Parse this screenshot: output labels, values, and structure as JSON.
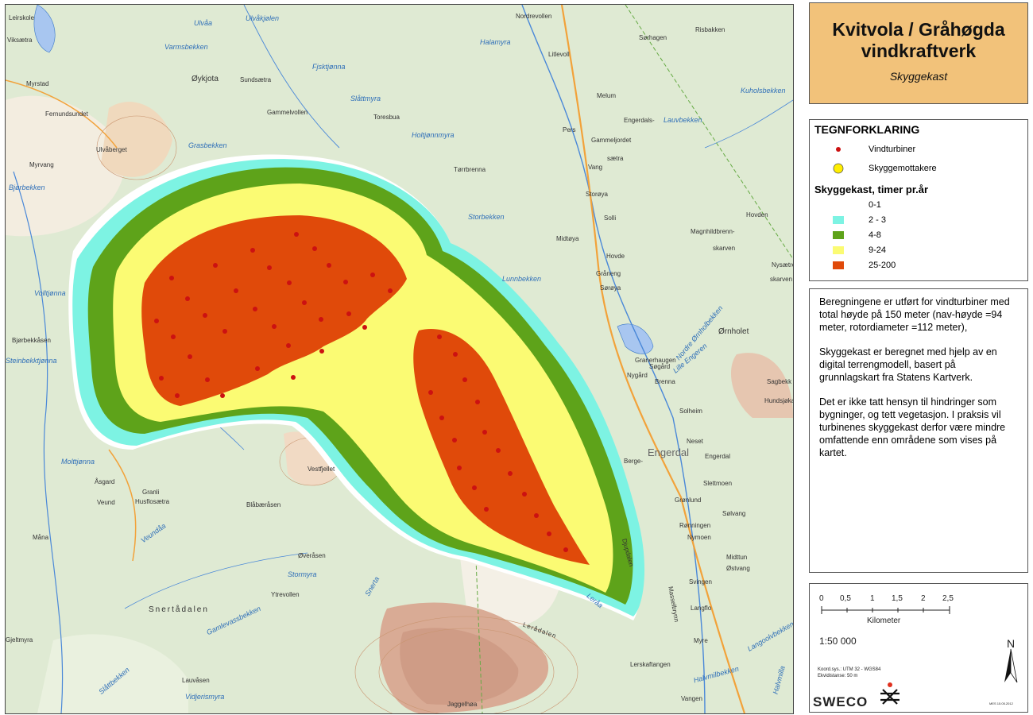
{
  "title": {
    "main": "Kvitvola / Gråhøgda vindkraftverk",
    "subtitle": "Skyggekast"
  },
  "legend": {
    "heading": "TEGNFORKLARING",
    "symbols": [
      {
        "label": "Vindturbiner",
        "color": "#cc1111"
      },
      {
        "label": "Skyggemottakere",
        "color": "#ffee00"
      }
    ],
    "classes_heading": "Skyggekast, timer pr.år",
    "classes": [
      {
        "label": "0-1",
        "color": "#ffffff"
      },
      {
        "label": "2 - 3",
        "color": "#7df3e3"
      },
      {
        "label": "4-8",
        "color": "#5ea31a"
      },
      {
        "label": "9-24",
        "color": "#fbfb73"
      },
      {
        "label": "25-200",
        "color": "#e04a0a"
      }
    ]
  },
  "notes": [
    "Beregningene er utført for vindturbiner med total høyde på 150 meter (nav-høyde =94 meter, rotordiameter =112 meter),",
    "Skyggekast er beregnet med hjelp av en digital terrengmodell, basert på grunnlagskart fra Statens Kartverk.",
    "Det er ikke tatt hensyn til hindringer som bygninger, og tett vegetasjon. I praksis vil turbinenes skyggekast derfor være mindre omfattende enn områdene som vises på kartet."
  ],
  "scalebar": {
    "ticks": [
      "0",
      "0,5",
      "1",
      "1,5",
      "2",
      "2,5"
    ],
    "unit": "Kilometer",
    "ratio": "1:50 000",
    "coord_sys": "Koord.sys.: UTM 32 - WGS84",
    "equidistance": "Ekvidistanse: 50 m",
    "north": "N",
    "logo": "SWECO",
    "stamp": "MES 15.05.2012"
  },
  "map_labels": [
    {
      "text": "Leirskole",
      "kind": "place"
    },
    {
      "text": "Viksætra",
      "kind": "place"
    },
    {
      "text": "Ulvåa",
      "kind": "water"
    },
    {
      "text": "Ulvåkjølen",
      "kind": "water"
    },
    {
      "text": "Varmsbekken",
      "kind": "water"
    },
    {
      "text": "Nordrevollen",
      "kind": "place"
    },
    {
      "text": "Halamyra",
      "kind": "water"
    },
    {
      "text": "Litlevoll",
      "kind": "place"
    },
    {
      "text": "Risbakken",
      "kind": "place"
    },
    {
      "text": "Sørhagen",
      "kind": "place"
    },
    {
      "text": "Myrstad",
      "kind": "place"
    },
    {
      "text": "Fjsktjønna",
      "kind": "water"
    },
    {
      "text": "Øykjota",
      "kind": "big"
    },
    {
      "text": "Sundsætra",
      "kind": "place"
    },
    {
      "text": "Slåttmyra",
      "kind": "water"
    },
    {
      "text": "Melum",
      "kind": "place"
    },
    {
      "text": "Kuholsbekken",
      "kind": "water"
    },
    {
      "text": "Fernundsundet",
      "kind": "place"
    },
    {
      "text": "Gammelvollen",
      "kind": "place"
    },
    {
      "text": "Toresbua",
      "kind": "place"
    },
    {
      "text": "Engerdals-",
      "kind": "place"
    },
    {
      "text": "Lauvbekken",
      "kind": "water"
    },
    {
      "text": "Ulvåberget",
      "kind": "place"
    },
    {
      "text": "Grasbekken",
      "kind": "water"
    },
    {
      "text": "Holtjønnmyra",
      "kind": "water"
    },
    {
      "text": "Pers",
      "kind": "place"
    },
    {
      "text": "Gammeljordet",
      "kind": "place"
    },
    {
      "text": "Myrvang",
      "kind": "place"
    },
    {
      "text": "Bjørbekken",
      "kind": "water"
    },
    {
      "text": "Tørrbrenna",
      "kind": "place"
    },
    {
      "text": "sætra",
      "kind": "place"
    },
    {
      "text": "Vang",
      "kind": "place"
    },
    {
      "text": "Storøya",
      "kind": "place"
    },
    {
      "text": "Storbekken",
      "kind": "water"
    },
    {
      "text": "Solli",
      "kind": "place"
    },
    {
      "text": "Hovden",
      "kind": "place"
    },
    {
      "text": "Magnhildbrenn-",
      "kind": "place"
    },
    {
      "text": "skarven",
      "kind": "place"
    },
    {
      "text": "Midtøya",
      "kind": "place"
    },
    {
      "text": "Lunnbekken",
      "kind": "water"
    },
    {
      "text": "Hovde",
      "kind": "place"
    },
    {
      "text": "Nysætre",
      "kind": "place"
    },
    {
      "text": "skarven",
      "kind": "place"
    },
    {
      "text": "Volltjønna",
      "kind": "water"
    },
    {
      "text": "Gråneng",
      "kind": "place"
    },
    {
      "text": "Sørøya",
      "kind": "place"
    },
    {
      "text": "Nordre Ørnholbekken",
      "kind": "water"
    },
    {
      "text": "Ørnholet",
      "kind": "big"
    },
    {
      "text": "Bjørbekkåsen",
      "kind": "place"
    },
    {
      "text": "Steinbekktjønna",
      "kind": "water"
    },
    {
      "text": "Lille Engeren",
      "kind": "water"
    },
    {
      "text": "Granerhaugen",
      "kind": "place"
    },
    {
      "text": "Sagbekk",
      "kind": "place"
    },
    {
      "text": "Hundsjøkar",
      "kind": "place"
    },
    {
      "text": "Nygård",
      "kind": "place"
    },
    {
      "text": "Søgård",
      "kind": "place"
    },
    {
      "text": "Brenna",
      "kind": "place"
    },
    {
      "text": "Solheim",
      "kind": "place"
    },
    {
      "text": "Neset",
      "kind": "place"
    },
    {
      "text": "Engerdal",
      "kind": "big"
    },
    {
      "text": "Engerdal",
      "kind": "place"
    },
    {
      "text": "Molttjønna",
      "kind": "water"
    },
    {
      "text": "Vestfjellet",
      "kind": "place"
    },
    {
      "text": "Berge-",
      "kind": "place"
    },
    {
      "text": "Åsgard",
      "kind": "place"
    },
    {
      "text": "Granli",
      "kind": "place"
    },
    {
      "text": "Veund",
      "kind": "place"
    },
    {
      "text": "Husflosætra",
      "kind": "place"
    },
    {
      "text": "Slettmoen",
      "kind": "place"
    },
    {
      "text": "Grønlund",
      "kind": "place"
    },
    {
      "text": "Sølvang",
      "kind": "place"
    },
    {
      "text": "Veundåa",
      "kind": "water"
    },
    {
      "text": "Blåbæråsen",
      "kind": "place"
    },
    {
      "text": "Rønningen",
      "kind": "place"
    },
    {
      "text": "Nymoen",
      "kind": "place"
    },
    {
      "text": "Måna",
      "kind": "place"
    },
    {
      "text": "Djupdalen",
      "kind": "place"
    },
    {
      "text": "Øveråsen",
      "kind": "place"
    },
    {
      "text": "Midttun",
      "kind": "place"
    },
    {
      "text": "Østvang",
      "kind": "place"
    },
    {
      "text": "Stormyra",
      "kind": "water"
    },
    {
      "text": "Ytrevollen",
      "kind": "place"
    },
    {
      "text": "Snerta",
      "kind": "water"
    },
    {
      "text": "Svingen",
      "kind": "place"
    },
    {
      "text": "Snertådalen",
      "kind": "big"
    },
    {
      "text": "Gamlevassbekken",
      "kind": "water"
    },
    {
      "text": "Leråa",
      "kind": "water"
    },
    {
      "text": "Langflo",
      "kind": "place"
    },
    {
      "text": "Gjeltmyra",
      "kind": "place"
    },
    {
      "text": "Lerådalen",
      "kind": "place"
    },
    {
      "text": "Myre",
      "kind": "place"
    },
    {
      "text": "Masselbrynn",
      "kind": "place"
    },
    {
      "text": "Langoolvbekken",
      "kind": "water"
    },
    {
      "text": "Lerskaftangen",
      "kind": "place"
    },
    {
      "text": "Halvmilbekken",
      "kind": "water"
    },
    {
      "text": "Lauvåsen",
      "kind": "place"
    },
    {
      "text": "Vidjerismyra",
      "kind": "water"
    },
    {
      "text": "Slåttbekken",
      "kind": "water"
    },
    {
      "text": "Jaggelhøa",
      "kind": "place"
    },
    {
      "text": "Vangen",
      "kind": "place"
    },
    {
      "text": "Halvmilla",
      "kind": "water"
    }
  ]
}
